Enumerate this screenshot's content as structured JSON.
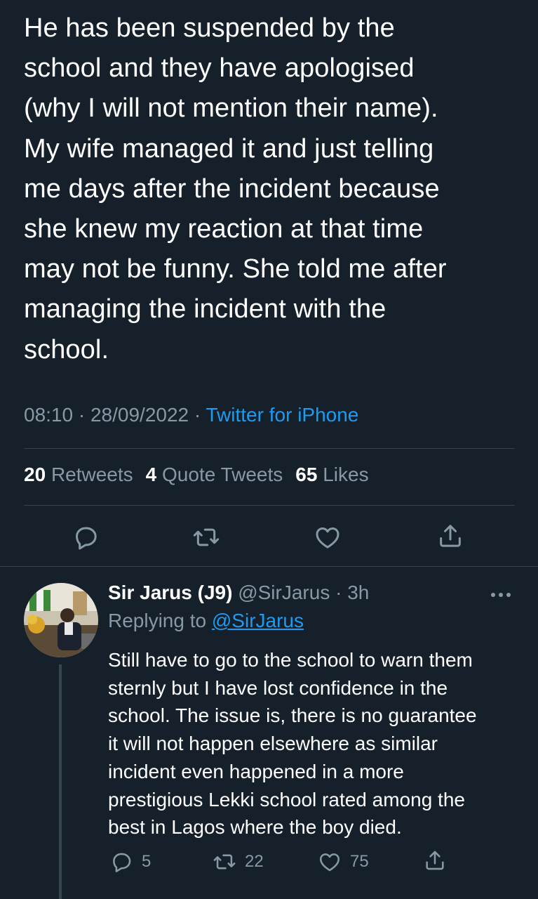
{
  "main_tweet": {
    "text_lines": [
      "He has been suspended by the",
      "school and they have apologised",
      "(why I will not mention their name).",
      "My wife managed it and just telling",
      "me days after the incident because",
      "she knew my reaction at that time",
      "may not be funny. She told me after",
      "managing the incident with the",
      "school."
    ],
    "time": "08:10",
    "date": "28/09/2022",
    "source": "Twitter for iPhone",
    "stats": {
      "retweets_count": "20",
      "retweets_label": "Retweets",
      "quotes_count": "4",
      "quotes_label": "Quote Tweets",
      "likes_count": "65",
      "likes_label": "Likes"
    }
  },
  "reply": {
    "display_name": "Sir Jarus (J9)",
    "handle": "@SirJarus",
    "age": "3h",
    "replying_prefix": "Replying to",
    "replying_to": "@SirJarus",
    "text_lines": [
      "Still have to go to the school to warn them",
      "sternly but I have lost confidence in the",
      "school. The issue is, there is no guarantee",
      "it will not happen elsewhere as similar",
      "incident even happened in a more",
      "prestigious Lekki school rated among the",
      "best in Lagos where the boy died."
    ],
    "replies_count": "5",
    "retweets_count": "22",
    "likes_count": "75"
  },
  "colors": {
    "background": "#15202b",
    "text_primary": "#ffffff",
    "text_secondary": "#8899a6",
    "accent": "#1d9bf0",
    "divider": "#38444d"
  },
  "icons": [
    "reply-icon",
    "retweet-icon",
    "like-icon",
    "share-icon",
    "more-icon"
  ]
}
